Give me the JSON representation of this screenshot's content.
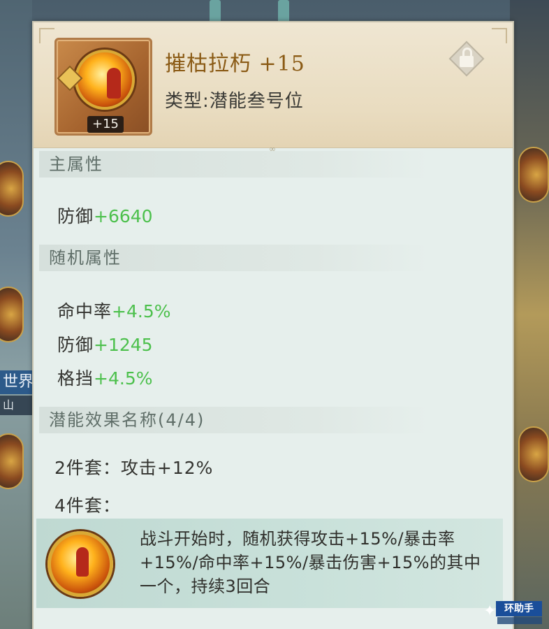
{
  "item": {
    "name": "摧枯拉朽 +15",
    "type": "类型:潜能叁号位",
    "level_badge": "+15"
  },
  "sections": {
    "main_attr": {
      "title": "主属性",
      "stats": [
        {
          "label": "防御",
          "value": "+6640"
        }
      ]
    },
    "random_attr": {
      "title": "随机属性",
      "stats": [
        {
          "label": "命中率",
          "value": "+4.5%"
        },
        {
          "label": "防御",
          "value": "+1245"
        },
        {
          "label": "格挡",
          "value": "+4.5%"
        }
      ]
    },
    "potential": {
      "title": "潜能效果名称(4/4)",
      "set2": "2件套：攻击+12%",
      "set4": "4件套：",
      "effect_text": "战斗开始时，随机获得攻击+15%/暴击率+15%/命中率+15%/暴击伤害+15%的其中一个，持续3回合"
    }
  },
  "background": {
    "world_tag": "世界",
    "world_sub": "山"
  },
  "watermark": {
    "label": "环助手"
  },
  "colors": {
    "stat_value": "#4cc04c",
    "item_name": "#8a5a14",
    "panel_bg": "#e6efec",
    "header_bg": "#e9dcc0"
  },
  "icons": [
    "lock-icon",
    "item-emblem-icon",
    "effect-emblem-icon"
  ]
}
